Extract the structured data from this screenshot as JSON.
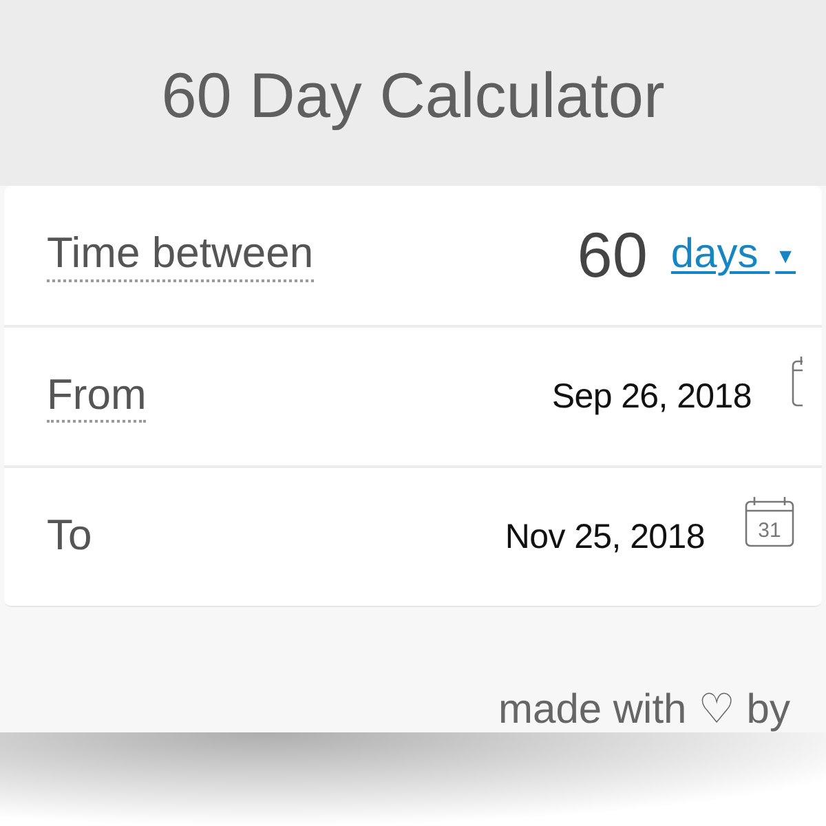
{
  "title": "60 Day Calculator",
  "fields": [
    {
      "kind": "duration",
      "label": "Time between",
      "has_hint": true,
      "value": "60",
      "unit": {
        "label": "days",
        "caret": "▼"
      }
    },
    {
      "kind": "date",
      "label": "From",
      "has_hint": true,
      "value": "Sep 26, 2018"
    },
    {
      "kind": "date",
      "label": "To",
      "has_hint": false,
      "value": "Nov 25, 2018",
      "calendar_label": "31"
    }
  ],
  "footer": {
    "text": "made with ♡ by"
  }
}
